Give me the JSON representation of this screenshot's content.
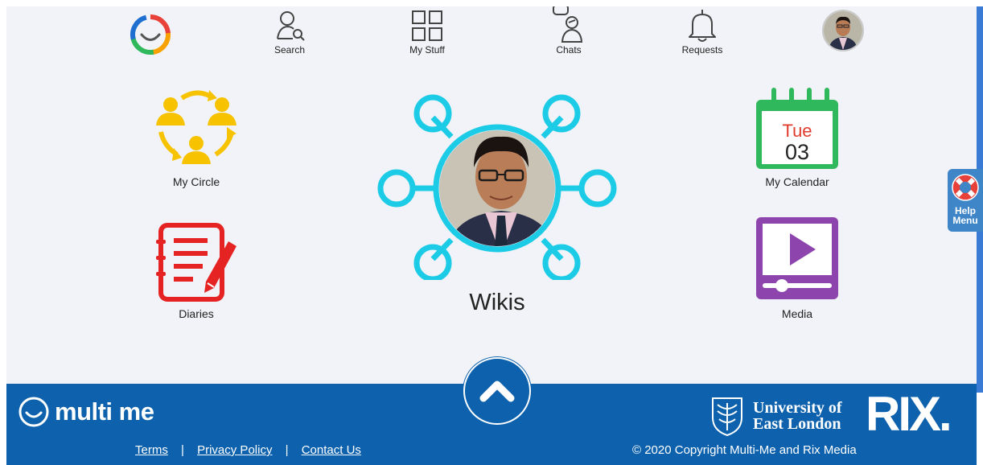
{
  "topnav": {
    "search_label": "Search",
    "mystuff_label": "My Stuff",
    "chats_label": "Chats",
    "requests_label": "Requests"
  },
  "tiles": {
    "circle_label": "My Circle",
    "calendar_label": "My Calendar",
    "calendar_day": "Tue",
    "calendar_date": "03",
    "diaries_label": "Diaries",
    "media_label": "Media",
    "wikis_label": "Wikis"
  },
  "help": {
    "line1": "Help",
    "line2": "Menu"
  },
  "footer": {
    "brand": "multi me",
    "terms": "Terms",
    "privacy": "Privacy Policy",
    "contact": "Contact Us",
    "separator": "|",
    "copyright": "© 2020 Copyright Multi-Me and Rix Media",
    "uel_line1": "University of",
    "uel_line2": "East London",
    "rix": "RIX."
  },
  "colors": {
    "background": "#f2f3f8",
    "footer": "#0e62ad",
    "circle_yellow": "#f7c300",
    "wiki_cyan": "#1ccbe6",
    "calendar_green": "#2fb85c",
    "diaries_red": "#e52323",
    "media_purple": "#8e44ad"
  }
}
